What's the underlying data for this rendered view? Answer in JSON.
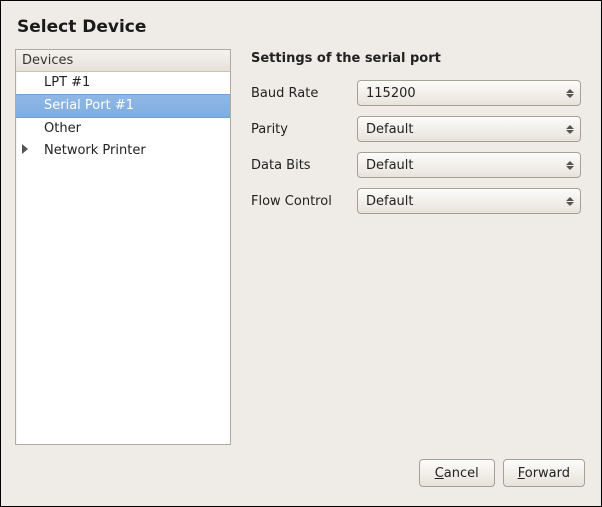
{
  "title": "Select Device",
  "tree": {
    "header": "Devices",
    "items": [
      {
        "label": "LPT #1",
        "selected": false,
        "expandable": false
      },
      {
        "label": "Serial Port #1",
        "selected": true,
        "expandable": false
      },
      {
        "label": "Other",
        "selected": false,
        "expandable": false
      },
      {
        "label": "Network Printer",
        "selected": false,
        "expandable": true
      }
    ]
  },
  "settings": {
    "heading": "Settings of the serial port",
    "fields": {
      "baud_rate": {
        "label": "Baud Rate",
        "value": "115200"
      },
      "parity": {
        "label": "Parity",
        "value": "Default"
      },
      "data_bits": {
        "label": "Data Bits",
        "value": "Default"
      },
      "flow_control": {
        "label": "Flow Control",
        "value": "Default"
      }
    }
  },
  "buttons": {
    "cancel_mnemonic": "C",
    "cancel_rest": "ancel",
    "forward_mnemonic": "F",
    "forward_rest": "orward"
  }
}
